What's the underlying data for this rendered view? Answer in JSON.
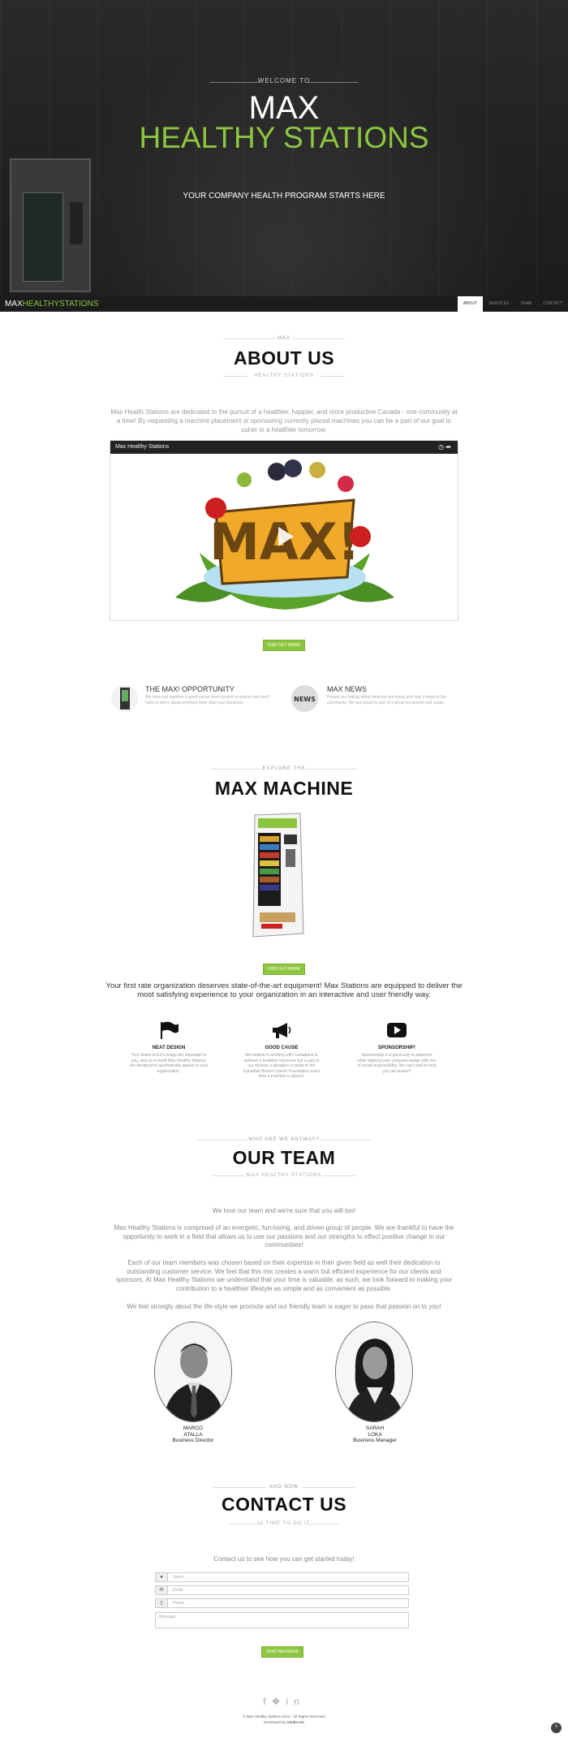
{
  "hero": {
    "welcome": "WELCOME TO",
    "title_line1": "MAX",
    "title_line2": "HEALTHY STATIONS",
    "tagline": "YOUR COMPANY HEALTH PROGRAM STARTS HERE"
  },
  "navbar": {
    "brand_max": "MAX",
    "brand_rest": "HEALTHYSTATIONS",
    "items": [
      "ABOUT",
      "SERVICES",
      "TEAM",
      "CONTACT"
    ]
  },
  "about": {
    "kicker": "MAX",
    "title": "ABOUT US",
    "subtitle": "HEALTHY STATIONS",
    "text": "Max Health Stations are dedicated to the pursuit of a healthier, happier, and more productive Canada - one community at a time! By requesting a machine placement or sponsoring currently placed machines you can be a part of our goal to usher in a healthier tomorrow.",
    "video_title": "Max Healthy Stations",
    "logo_text": "MAX!",
    "button": "FIND OUT MORE",
    "items": [
      {
        "title": "THE MAX! OPPORTUNITY",
        "text": "We have put together a good career-level system to ensure you don't have to worry about anything other than your business."
      },
      {
        "title": "MAX NEWS",
        "text": "People are talking about what we are doing and how it impacts the community. We are proud to part of a great movement and cause.",
        "icon_label": "NEWS"
      }
    ]
  },
  "machine": {
    "kicker": "EXPLORE THE",
    "title": "MAX MACHINE",
    "button": "FIND OUT MORE",
    "text": "Your first rate organization deserves state-of-the-art equipment! Max Stations are equipped to deliver the most satisfying experience to your organization in an interactive and user friendly way.",
    "features": [
      {
        "icon": "flag-icon",
        "title": "NEAT DESIGN",
        "text": "Your brand and it's image are important to you, and as a result Max Healthy Stations are designed to aesthetically appeal to your organization."
      },
      {
        "icon": "megaphone-icon",
        "title": "GOOD CAUSE",
        "text": "We believe in working with Canadians to achieve a healthier tomorrow but a part of our mission a donation is made to the Canadian Breast Cancer Foundation every time a machine is placed."
      },
      {
        "icon": "play-icon",
        "title": "SPONSORSHIP!",
        "text": "Sponsorship is a great way to advertise while aligning your company image with one of social responsibility. We can't wait to help you get started!"
      }
    ]
  },
  "team": {
    "kicker": "WHO ARE WE ANYWAY?",
    "title": "OUR TEAM",
    "subtitle": "MAX HEALTHY STATIONS",
    "paragraphs": [
      "We love our team and we're sure that you will too!",
      "Max Healthy Stations is comprised of an energetic, fun-loving, and driven group of people. We are thankful to have the opportunity to work in a field that allows us to use our passions and our strengths to effect positive change in our communities!",
      "Each of our team members was chosen based on their expertise in their given field as well their dedication to outstanding customer service. We feel that this mix creates a warm but efficient experience for our clients and sponsors. At Max Healthy Stations we understand that your time is valuable, as such, we look forward to making your contribution to a healthier lifestyle as simple and as convenient as possible.",
      "We feel strongly about the life-style we promote and our friendly team is eager to pass that passion on to you!"
    ],
    "members": [
      {
        "first": "MARCO",
        "last": "ATALLA",
        "role": "Business Director"
      },
      {
        "first": "SARAH",
        "last": "LOKA",
        "role": "Business Manager"
      }
    ]
  },
  "contact": {
    "kicker": "AND NOW",
    "title": "CONTACT US",
    "subtitle": "IS TIME TO DO IT",
    "text": "Contact us to see how you can get started today!",
    "fields": {
      "name": "Name",
      "email": "Email",
      "phone": "Phone",
      "message": "Message"
    },
    "send": "SEND MESSAGE"
  },
  "footer": {
    "copyright": "© Max Healthy Stations 2013 - All Rights Reserved",
    "developed_by": "Developed by",
    "developer": "media rex"
  },
  "colors": {
    "accent": "#8dc63f",
    "dark": "#1c1c1c"
  }
}
